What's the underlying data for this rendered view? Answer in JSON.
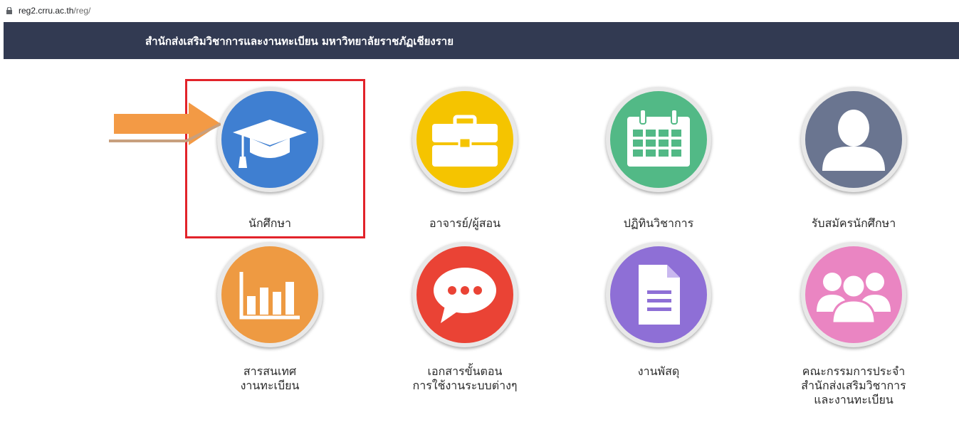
{
  "browser": {
    "url_host": "reg2.crru.ac.th",
    "url_path": "/reg/"
  },
  "header": {
    "title": "สำนักส่งเสริมวิชาการและงานทะเบียน มหาวิทยาลัยราชภัฏเชียงราย"
  },
  "tiles": [
    {
      "label": "นักศึกษา",
      "icon": "graduation-cap-icon",
      "color": "#3f7fd1"
    },
    {
      "label": "อาจารย์/ผู้สอน",
      "icon": "briefcase-icon",
      "color": "#f5c400"
    },
    {
      "label": "ปฏิทินวิชาการ",
      "icon": "calendar-icon",
      "color": "#52b986"
    },
    {
      "label": "รับสมัครนักศึกษา",
      "icon": "user-icon",
      "color": "#6a7590"
    },
    {
      "label_lines": [
        "สารสนเทศ",
        "งานทะเบียน"
      ],
      "icon": "bar-chart-icon",
      "color": "#ee9a42"
    },
    {
      "label_lines": [
        "เอกสารขั้นตอน",
        "การใช้งานระบบต่างๆ"
      ],
      "icon": "chat-bubble-icon",
      "color": "#ea4335"
    },
    {
      "label": "งานพัสดุ",
      "icon": "document-icon",
      "color": "#8e6fd6"
    },
    {
      "label_lines": [
        "คณะกรรมการประจำ",
        "สำนักส่งเสริมวิชาการ",
        "และงานทะเบียน"
      ],
      "icon": "group-icon",
      "color": "#ea85c2"
    }
  ]
}
